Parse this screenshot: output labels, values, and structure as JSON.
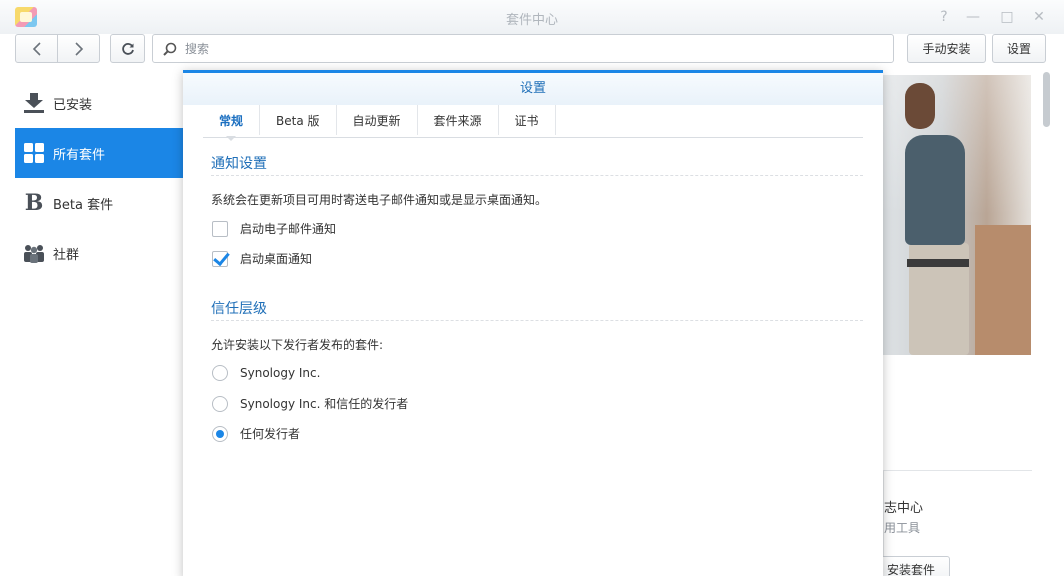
{
  "window": {
    "title": "套件中心",
    "controls": [
      {
        "name": "help-icon",
        "glyph": "?"
      },
      {
        "name": "minimize-icon",
        "glyph": "—"
      },
      {
        "name": "maximize-icon",
        "glyph": "□"
      },
      {
        "name": "close-icon",
        "glyph": "✕"
      }
    ]
  },
  "toolbar": {
    "search_placeholder": "搜索",
    "manual_install_label": "手动安装",
    "settings_label": "设置"
  },
  "sidebar": {
    "items": [
      {
        "label": "已安装",
        "icon": "download-icon",
        "active": false
      },
      {
        "label": "所有套件",
        "icon": "grid-icon",
        "active": true
      },
      {
        "label": "Beta 套件",
        "icon": "beta-icon",
        "active": false
      },
      {
        "label": "社群",
        "icon": "community-icon",
        "active": false
      }
    ]
  },
  "background": {
    "card_title": "志中心",
    "card_subtitle": "用工具",
    "card_button": "安装套件"
  },
  "dialog": {
    "title": "设置",
    "tabs": [
      {
        "label": "常规",
        "active": true
      },
      {
        "label": "Beta 版",
        "active": false
      },
      {
        "label": "自动更新",
        "active": false
      },
      {
        "label": "套件来源",
        "active": false
      },
      {
        "label": "证书",
        "active": false
      }
    ],
    "notify": {
      "title": "通知设置",
      "description": "系统会在更新项目可用时寄送电子邮件通知或是显示桌面通知。",
      "options": [
        {
          "label": "启动电子邮件通知",
          "checked": false
        },
        {
          "label": "启动桌面通知",
          "checked": true
        }
      ]
    },
    "trust": {
      "title": "信任层级",
      "description": "允许安装以下发行者发布的套件:",
      "options": [
        {
          "label": "Synology Inc.",
          "selected": false
        },
        {
          "label": "Synology Inc. 和信任的发行者",
          "selected": false
        },
        {
          "label": "任何发行者",
          "selected": true
        }
      ]
    }
  },
  "colors": {
    "accent": "#1b86e6",
    "title_blue": "#1f6fb8"
  }
}
